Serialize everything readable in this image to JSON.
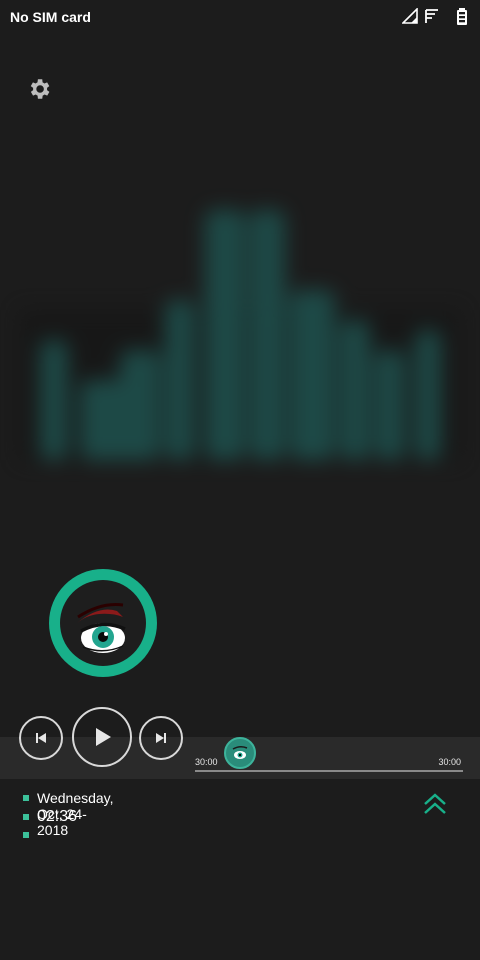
{
  "status_bar": {
    "carrier_text": "No SIM card",
    "icons": [
      "signal-icon",
      "wifi-icon",
      "battery-icon"
    ]
  },
  "controls": {
    "settings_icon": "gear-icon",
    "prev_icon": "skip-previous-icon",
    "play_icon": "play-icon",
    "next_icon": "skip-next-icon"
  },
  "seek": {
    "time_elapsed": "30:00",
    "time_total": "30:00"
  },
  "info": {
    "date": "Wednesday, Oct, 24-2018",
    "time": "02:36"
  },
  "colors": {
    "background": "#1c1c1c",
    "accent": "#18b08a",
    "bullet": "#3cc19a",
    "strip": "#2a2a2a"
  }
}
